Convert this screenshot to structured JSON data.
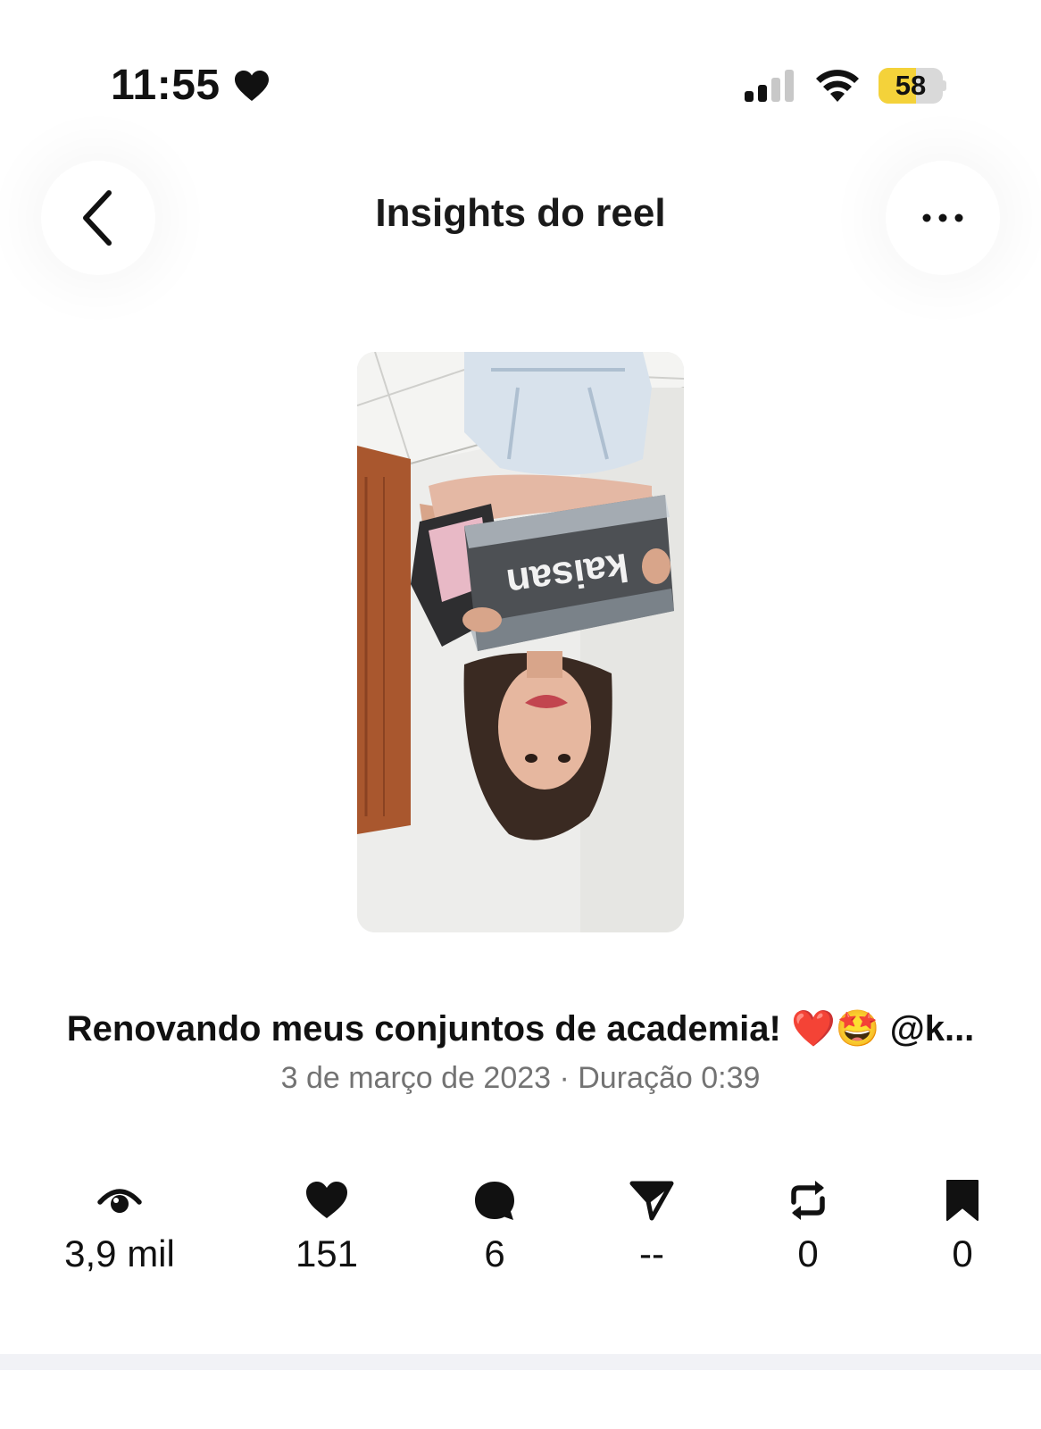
{
  "status_bar": {
    "time": "11:55",
    "battery_percent": "58",
    "battery_level": 0.58
  },
  "header": {
    "title": "Insights do reel",
    "back_icon": "chevron-left-icon",
    "more_icon": "ellipsis-icon"
  },
  "reel": {
    "thumbnail_overlay_text": "kaisan",
    "caption": "Renovando meus conjuntos de academia! ❤️🤩 @k...",
    "meta": "3 de março de 2023 · Duração 0:39"
  },
  "metrics": [
    {
      "icon": "eye-icon",
      "value": "3,9 mil"
    },
    {
      "icon": "heart-icon",
      "value": "151"
    },
    {
      "icon": "comment-icon",
      "value": "6"
    },
    {
      "icon": "share-icon",
      "value": "--"
    },
    {
      "icon": "repost-icon",
      "value": "0"
    },
    {
      "icon": "bookmark-icon",
      "value": "0"
    }
  ],
  "colors": {
    "text": "#111111",
    "meta_text": "#737373",
    "battery_fill": "#f4d23a",
    "divider": "#f1f2f6"
  }
}
